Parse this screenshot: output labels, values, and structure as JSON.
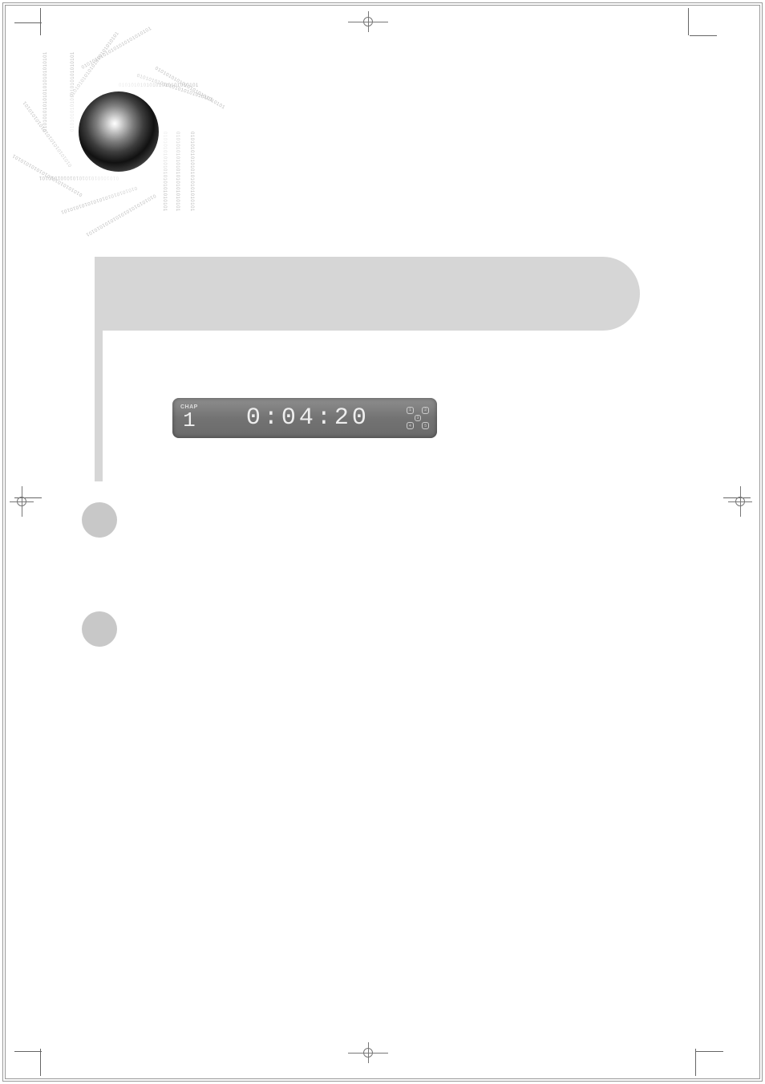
{
  "logo": {
    "binary_text": "01010101010101010101010101"
  },
  "display_panel": {
    "chap_label": "CHAP",
    "chap_number": "1",
    "time": "0:04:20",
    "speaker_grid": [
      "1",
      "2",
      "",
      "3",
      "",
      "4",
      "5"
    ]
  }
}
